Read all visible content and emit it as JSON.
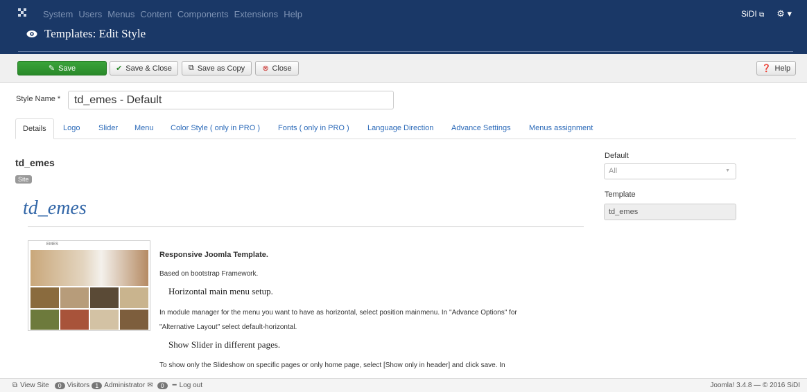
{
  "topnav": {
    "menu": [
      "System",
      "Users",
      "Menus",
      "Content",
      "Components",
      "Extensions",
      "Help"
    ],
    "user": "SiDI",
    "colors": {
      "bar": "#1a3867",
      "text": "#7e93b4"
    }
  },
  "header": {
    "title": "Templates: Edit Style"
  },
  "toolbar": {
    "save": "Save",
    "save_close": "Save & Close",
    "save_copy": "Save as Copy",
    "close": "Close",
    "help": "Help"
  },
  "form": {
    "style_name_label": "Style Name *",
    "style_name_value": "td_emes - Default"
  },
  "tabs": [
    "Details",
    "Logo",
    "Slider",
    "Menu",
    "Color Style ( only in PRO )",
    "Fonts ( only in PRO )",
    "Language Direction",
    "Advance Settings",
    "Menus assignment"
  ],
  "details": {
    "template_name": "td_emes",
    "badge": "Site",
    "big_title": "td_emes",
    "preview_caption": "EMES",
    "heading1": "Responsive Joomla Template.",
    "line1": "Based on bootstrap Framework.",
    "heading2": "Horizontal main menu setup.",
    "para1a": "In module manager for the menu you want to have as horizontal, select position mainmenu. In \"Advance Options\" for",
    "para1b": "\"Alternative Layout\" select default-horizontal.",
    "heading3": "Show Slider in different pages.",
    "para2": "To show only the Slideshow on specific pages or only home page, select [Show only in header] and click save. In"
  },
  "sidebar": {
    "default_label": "Default",
    "default_value": "All",
    "template_label": "Template",
    "template_value": "td_emes"
  },
  "status": {
    "view_site": "View Site",
    "visitors_count": "0",
    "visitors": "Visitors",
    "admin_count": "1",
    "admin": "Administrator",
    "msg_count": "0",
    "logout": "Log out",
    "version": "Joomla! 3.4.8 — © 2016 SiDI"
  }
}
